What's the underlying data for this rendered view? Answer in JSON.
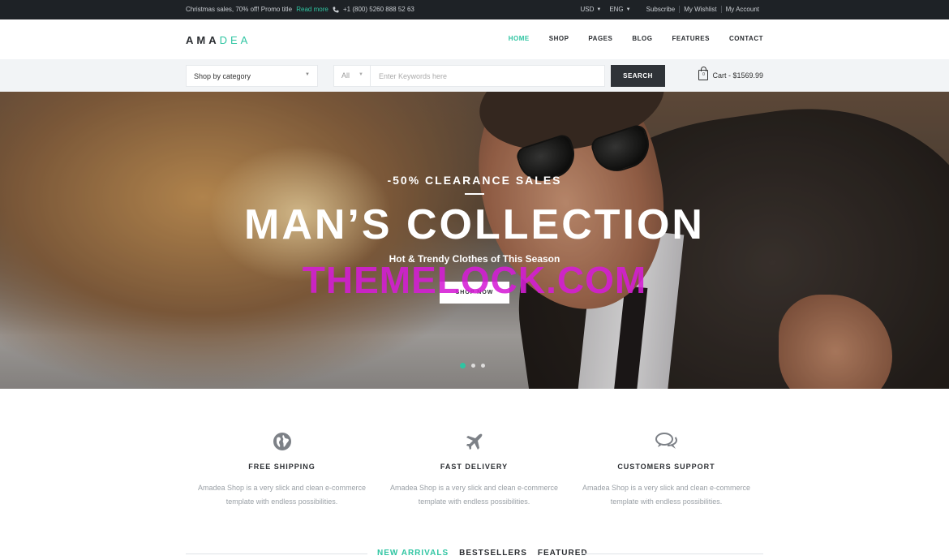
{
  "topbar": {
    "promo_text": "Christmas sales, 70% off! Promo title",
    "promo_link": "Read more",
    "phone": "+1 (800) 5260 888 52 63",
    "currency": "USD",
    "language": "ENG",
    "links": [
      "Subscribe",
      "My Wishlist",
      "My Account"
    ]
  },
  "header": {
    "logo_left": "AMA",
    "logo_right": "DEA",
    "nav": [
      "HOME",
      "SHOP",
      "PAGES",
      "BLOG",
      "FEATURES",
      "CONTACT"
    ],
    "nav_active": "HOME"
  },
  "search": {
    "category_label": "Shop by category",
    "scope_label": "All",
    "placeholder": "Enter Keywords here",
    "button_label": "SEARCH",
    "cart_count": "0",
    "cart_label": "Cart - $1569.99"
  },
  "hero": {
    "kicker": "-50% CLEARANCE SALES",
    "title": "MAN’S COLLECTION",
    "subtitle": "Hot & Trendy Clothes of This Season",
    "button_label": "SHOP NOW",
    "watermark": "THEMELOCK.COM",
    "slides": 3,
    "active_slide": 1
  },
  "features": [
    {
      "icon": "globe-icon",
      "title": "FREE SHIPPING",
      "desc": "Amadea Shop is a very slick and clean e-commerce template with endless possibilities."
    },
    {
      "icon": "airplane-icon",
      "title": "FAST DELIVERY",
      "desc": "Amadea Shop is a very slick and clean e-commerce template with endless possibilities."
    },
    {
      "icon": "chat-bubbles-icon",
      "title": "CUSTOMERS SUPPORT",
      "desc": "Amadea Shop is a very slick and clean e-commerce template with endless possibilities."
    }
  ],
  "tabs": [
    "NEW ARRIVALS",
    "BESTSELLERS",
    "FEATURED"
  ],
  "colors": {
    "accent": "#2fc5a2",
    "topbar": "#1e2226",
    "dark_button": "#2f3338",
    "watermark": "#d51dd6"
  }
}
